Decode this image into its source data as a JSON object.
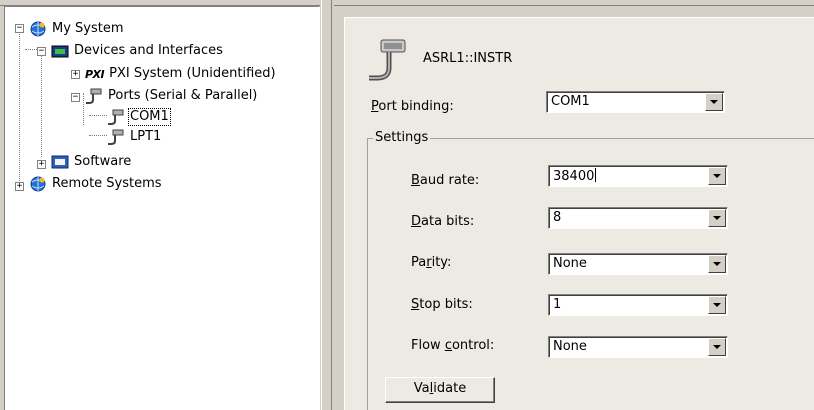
{
  "tree": {
    "items": [
      {
        "label": "My System",
        "icon": "network-globe-icon",
        "expander": "−"
      },
      {
        "label": "Devices and Interfaces",
        "icon": "devices-icon",
        "expander": "−"
      },
      {
        "label": "PXI System (Unidentified)",
        "prefix": "PXI",
        "icon": "pxi-icon",
        "expander": "+"
      },
      {
        "label": "Ports (Serial & Parallel)",
        "icon": "port-connector-icon",
        "expander": "−"
      },
      {
        "label": "COM1",
        "icon": "port-connector-icon",
        "selected": true
      },
      {
        "label": "LPT1",
        "icon": "port-connector-icon"
      },
      {
        "label": "Software",
        "icon": "software-icon",
        "expander": "+"
      },
      {
        "label": "Remote Systems",
        "icon": "network-globe-icon",
        "expander": "+"
      }
    ]
  },
  "resource": {
    "name": "ASRL1::INSTR",
    "icon": "serial-connector-icon"
  },
  "port_binding": {
    "label_pre": "",
    "label_hot": "P",
    "label_post": "ort binding:",
    "value": "COM1"
  },
  "settings": {
    "legend": "Settings",
    "fields": [
      {
        "hot": "B",
        "pre": "",
        "post": "aud rate:",
        "value": "38400"
      },
      {
        "hot": "D",
        "pre": "",
        "post": "ata bits:",
        "value": "8"
      },
      {
        "hot": "r",
        "pre": "Pa",
        "post": "ity:",
        "value": "None"
      },
      {
        "hot": "S",
        "pre": "",
        "post": "top bits:",
        "value": "1"
      },
      {
        "hot": "c",
        "pre": "Flow ",
        "post": "ontrol:",
        "value": "None"
      }
    ]
  },
  "validate": {
    "pre": "Va",
    "hot": "l",
    "post": "idate"
  },
  "colors": {
    "panel_bg": "#eceae2",
    "window_bg": "#d4d0c8",
    "tree_bg": "#ffffff"
  }
}
